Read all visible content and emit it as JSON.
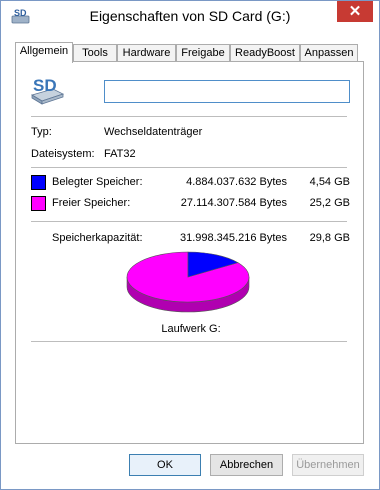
{
  "window": {
    "title": "Eigenschaften von SD Card (G:)",
    "close_label": "✕",
    "icon_text": "SD"
  },
  "tabs": [
    "Allgemein",
    "Tools",
    "Hardware",
    "Freigabe",
    "ReadyBoost",
    "Anpassen"
  ],
  "general": {
    "drive_icon_text": "SD",
    "name_value": "",
    "type_label": "Typ:",
    "type_value": "Wechseldatenträger",
    "fs_label": "Dateisystem:",
    "fs_value": "FAT32",
    "used": {
      "label": "Belegter Speicher:",
      "bytes": "4.884.037.632 Bytes",
      "size": "4,54 GB",
      "color": "#0000ff"
    },
    "free": {
      "label": "Freier Speicher:",
      "bytes": "27.114.307.584 Bytes",
      "size": "25,2 GB",
      "color": "#ff00ff"
    },
    "capacity": {
      "label": "Speicherkapazität:",
      "bytes": "31.998.345.216 Bytes",
      "size": "29,8 GB"
    },
    "pie_used_fraction": 0.1526,
    "drive_label": "Laufwerk G:"
  },
  "buttons": {
    "ok": "OK",
    "cancel": "Abbrechen",
    "apply": "Übernehmen"
  }
}
